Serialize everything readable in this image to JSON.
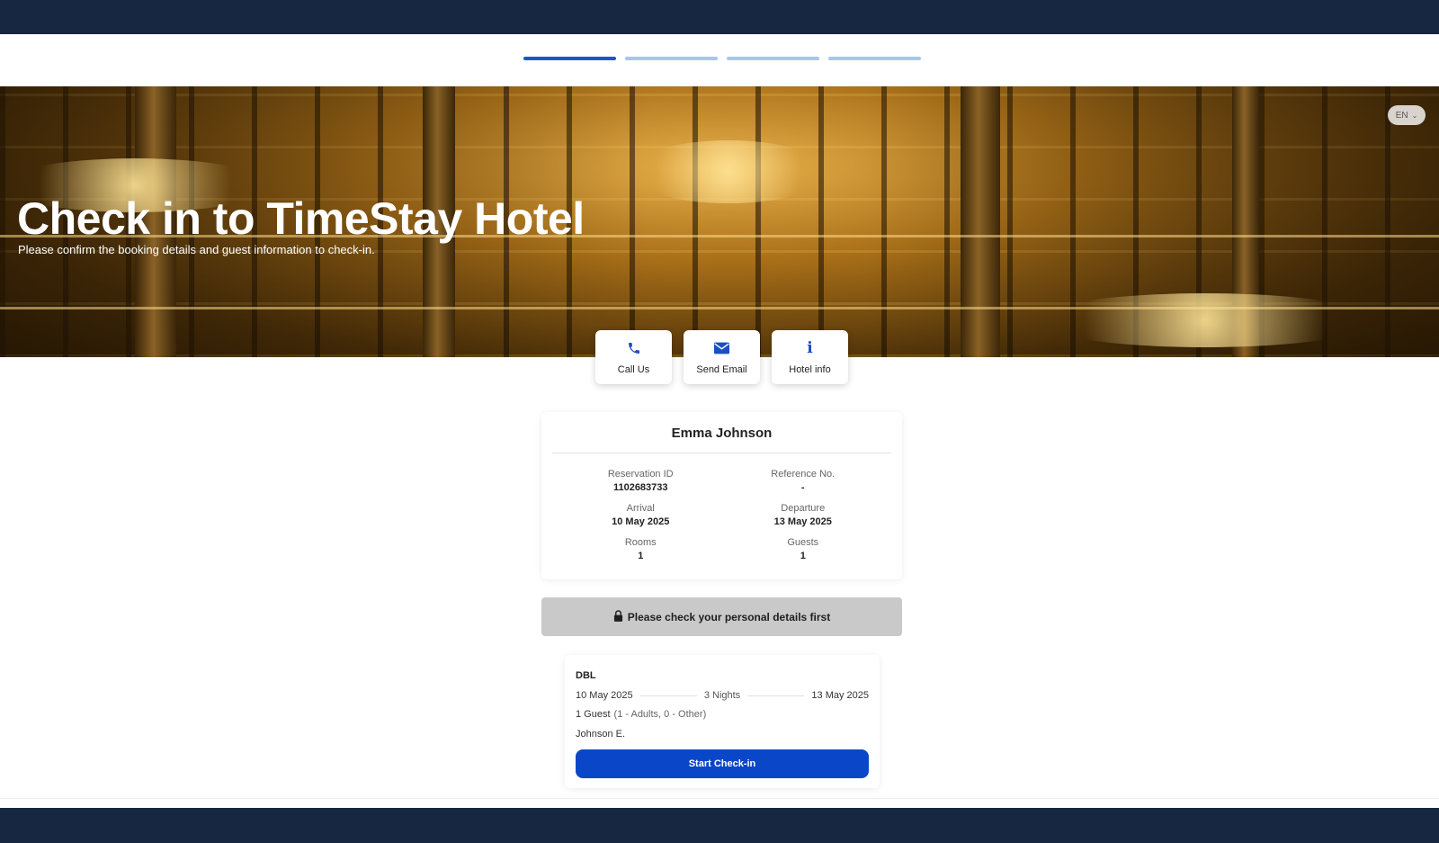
{
  "header": {
    "steps": [
      {
        "state": "active"
      },
      {
        "state": "inactive"
      },
      {
        "state": "inactive"
      },
      {
        "state": "inactive"
      }
    ]
  },
  "hero": {
    "title": "Check in to TimeStay Hotel",
    "subtitle": "Please confirm the booking details and guest information to check-in.",
    "language": "EN"
  },
  "actions": [
    {
      "label": "Call Us",
      "icon": "phone-icon"
    },
    {
      "label": "Send Email",
      "icon": "envelope-icon"
    },
    {
      "label": "Hotel info",
      "icon": "info-icon"
    }
  ],
  "booking": {
    "guest_name": "Emma Johnson",
    "fields": [
      {
        "label": "Reservation ID",
        "value": "1102683733"
      },
      {
        "label": "Reference No.",
        "value": "-"
      },
      {
        "label": "Arrival",
        "value": "10 May 2025"
      },
      {
        "label": "Departure",
        "value": "13 May 2025"
      },
      {
        "label": "Rooms",
        "value": "1"
      },
      {
        "label": "Guests",
        "value": "1"
      }
    ]
  },
  "notice": {
    "text": "Please check your personal details first",
    "icon": "lock-icon"
  },
  "room": {
    "type": "DBL",
    "arrival": "10 May 2025",
    "nights": "3 Nights",
    "departure": "13 May 2025",
    "guests": "1 Guest",
    "guests_detail": "(1 - Adults, 0 - Other)",
    "guest_name": "Johnson E.",
    "button_label": "Start Check-in"
  },
  "colors": {
    "navy": "#172641",
    "primary": "#0a47c8",
    "step_active": "#1a57cf",
    "step_inactive": "#a9c4f0"
  }
}
